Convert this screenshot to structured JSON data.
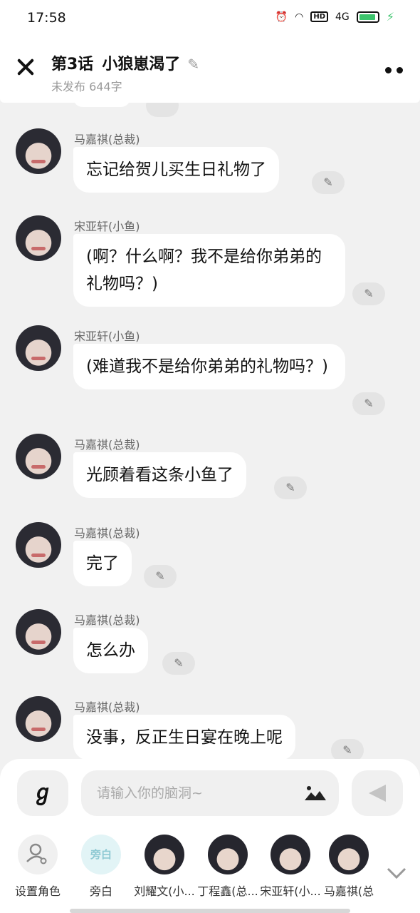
{
  "status_bar": {
    "time": "17:58",
    "network": "4G",
    "hd": "HD"
  },
  "header": {
    "chapter": "第3话",
    "title": "小狼崽渴了",
    "subtitle": "未发布 644字"
  },
  "messages": [
    {
      "name": "马嘉祺(总裁)",
      "text": "忘记给贺儿买生日礼物了"
    },
    {
      "name": "宋亚轩(小鱼)",
      "text": "(啊？什么啊？我不是给你弟弟的礼物吗？)"
    },
    {
      "name": "宋亚轩(小鱼)",
      "text": "(难道我不是给你弟弟的礼物吗？)"
    },
    {
      "name": "马嘉祺(总裁)",
      "text": "光顾着看这条小鱼了"
    },
    {
      "name": "马嘉祺(总裁)",
      "text": "完了"
    },
    {
      "name": "马嘉祺(总裁)",
      "text": "怎么办"
    },
    {
      "name": "马嘉祺(总裁)",
      "text": "没事，反正生日宴在晚上呢"
    }
  ],
  "composer": {
    "placeholder": "请输入你的脑洞~",
    "voice_icon": "voice-icon",
    "image_icon": "image-icon",
    "send_icon": "send-icon"
  },
  "roles": [
    {
      "label": "设置角色"
    },
    {
      "label": "旁白",
      "avatar_text": "旁白"
    },
    {
      "label": "刘耀文(小..."
    },
    {
      "label": "丁程鑫(总..."
    },
    {
      "label": "宋亚轩(小..."
    },
    {
      "label": "马嘉祺(总"
    }
  ],
  "colors": {
    "accent_green": "#3cc46c",
    "background": "#f1f1f1"
  }
}
